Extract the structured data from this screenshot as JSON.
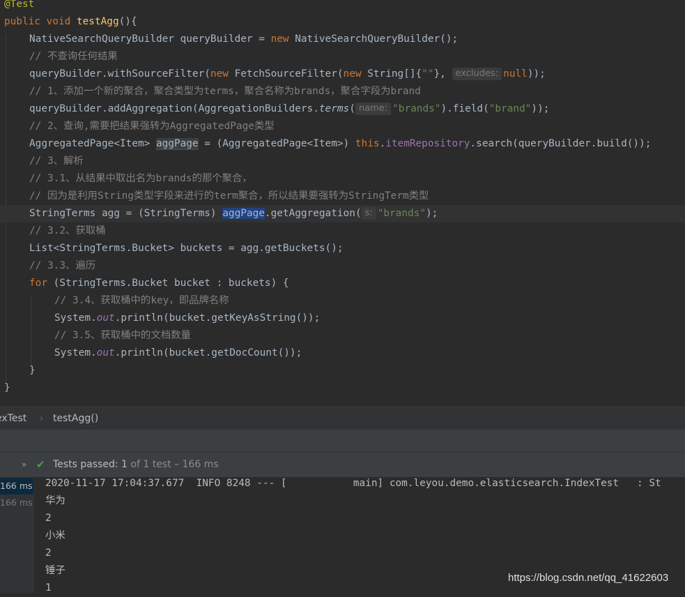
{
  "code": {
    "annotation": "@Test",
    "sig_public": "public",
    "sig_void": "void",
    "sig_name": "testAgg",
    "sig_rest": "(){",
    "l3_a": "NativeSearchQueryBuilder queryBuilder = ",
    "l3_new": "new",
    "l3_b": " NativeSearchQueryBuilder();",
    "l4": "// 不查询任何结果",
    "l5_a": "queryBuilder.withSourceFilter(",
    "l5_new1": "new",
    "l5_b": " FetchSourceFilter(",
    "l5_new2": "new",
    "l5_c": " String[]{",
    "l5_str": "\"\"",
    "l5_d": "}, ",
    "l5_hint": "excludes:",
    "l5_null": "null",
    "l5_e": "));",
    "l6": "// 1、添加一个新的聚合，聚合类型为terms，聚合名称为brands，聚合字段为brand",
    "l7_a": "queryBuilder.addAggregation(AggregationBuilders.",
    "l7_terms": "terms",
    "l7_b": "(",
    "l7_hint": "name:",
    "l7_str1": "\"brands\"",
    "l7_c": ").field(",
    "l7_str2": "\"brand\"",
    "l7_d": "));",
    "l8": "// 2、查询,需要把结果强转为AggregatedPage类型",
    "l9_a": "AggregatedPage<Item> ",
    "l9_var": "aggPage",
    "l9_b": " = (AggregatedPage<Item>) ",
    "l9_this": "this",
    "l9_c": ".",
    "l9_repo": "itemRepository",
    "l9_d": ".search(queryBuilder.build());",
    "l10": "// 3、解析",
    "l11": "// 3.1、从结果中取出名为brands的那个聚合，",
    "l12": "// 因为是利用String类型字段来进行的term聚合，所以结果要强转为StringTerm类型",
    "l13_a": "StringTerms agg = (StringTerms) ",
    "l13_var": "aggPage",
    "l13_b": ".getAggregation(",
    "l13_hint": "s:",
    "l13_str": "\"brands\"",
    "l13_c": ");",
    "l14": "// 3.2、获取桶",
    "l15": "List<StringTerms.Bucket> buckets = agg.getBuckets();",
    "l16": "// 3.3、遍历",
    "l17_for": "for",
    "l17_b": " (StringTerms.Bucket bucket : buckets) {",
    "l18": "// 3.4、获取桶中的key，即品牌名称",
    "l19_a": "System.",
    "l19_out": "out",
    "l19_b": ".println(bucket.getKeyAsString());",
    "l20": "// 3.5、获取桶中的文档数量",
    "l21_a": "System.",
    "l21_out": "out",
    "l21_b": ".println(bucket.getDocCount());",
    "l22": "}",
    "l23": "}"
  },
  "breadcrumb": {
    "class_name": "exTest",
    "separator": "›",
    "method_name": "testAgg()"
  },
  "status": {
    "expand": "»",
    "check": "✔",
    "label": "Tests passed:",
    "count": "1",
    "rest": "of 1 test – 166 ms"
  },
  "run_tree": [
    "166 ms",
    "166 ms"
  ],
  "console": {
    "log_line": "2020-11-17 17:04:37.677  INFO 8248 --- [           main] com.leyou.demo.elasticsearch.IndexTest   : St",
    "output": [
      "华为",
      "2",
      "小米",
      "2",
      "锤子",
      "1"
    ]
  },
  "watermark": "https://blog.csdn.net/qq_41622603",
  "colors": {
    "background": "#2b2b2b",
    "keyword": "#cc7832",
    "string": "#6a8759",
    "comment": "#808080",
    "method_decl": "#ffc66d",
    "field": "#9876aa",
    "annotation": "#bbb529",
    "passed": "#499c54",
    "selection": "#214283"
  }
}
